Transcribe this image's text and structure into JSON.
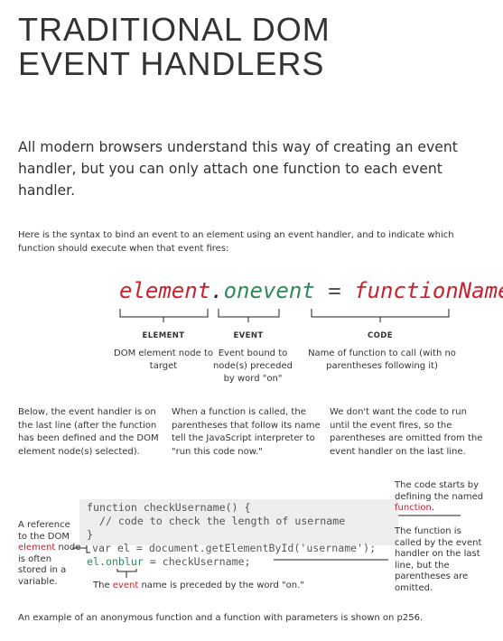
{
  "title": {
    "line1": "TRADITIONAL DOM",
    "line2": "EVENT HANDLERS"
  },
  "intro": "All modern browsers understand this way of creating an event handler, but you can only attach one function to each event handler.",
  "syntax_intro": "Here is the syntax to bind an event to an element using an event handler, and to indicate which function should execute when that event fires:",
  "syntax": {
    "element": "element",
    "dot": ".",
    "onevent": "onevent",
    "equals": "=",
    "function_name": "functionName",
    "semicolon": ";"
  },
  "labels": {
    "element": {
      "title": "ELEMENT",
      "desc": "DOM element node to target"
    },
    "event": {
      "title": "EVENT",
      "desc": "Event bound to node(s) preceded by word \"on\""
    },
    "code": {
      "title": "CODE",
      "desc": "Name of function to call (with no parentheses following it)"
    }
  },
  "columns": [
    "Below, the event handler is on the last line (after the function has been defined and the DOM element node(s) selected).",
    "When a function is called, the parentheses that follow its name tell the JavaScript interpreter to \"run this code now.\"",
    "We don't want the code to run until the event fires, so the parentheses are omitted from the event handler on the last line."
  ],
  "code": {
    "line1": "function checkUsername() {",
    "line2": "  // code to check the length of username",
    "line3": "}",
    "line4_var": "var el = document.getElementById('username');",
    "line5_el": "el",
    "line5_dot": ".",
    "line5_event": "onblur",
    "line5_rest": " = checkUsername;"
  },
  "notes": {
    "left_1": "A reference to the DOM ",
    "left_highlight": "element",
    "left_2": " node is often stored in a variable.",
    "right_top_1": "The code starts by defining the named ",
    "right_top_highlight": "function",
    "right_top_2": ".",
    "right_bottom": "The function is called by the event handler on the last line, but the parentheses are omitted.",
    "bottom_1": "The ",
    "bottom_highlight": "event",
    "bottom_2": " name is preceded by the word \"on.\""
  },
  "footer": "An example of an anonymous function and a function with parameters is shown on p256.",
  "colors": {
    "element": "#c8232c",
    "event": "#2e8b57",
    "function": "#c8232c",
    "text": "#333333",
    "code_bg": "#eeeeee"
  }
}
